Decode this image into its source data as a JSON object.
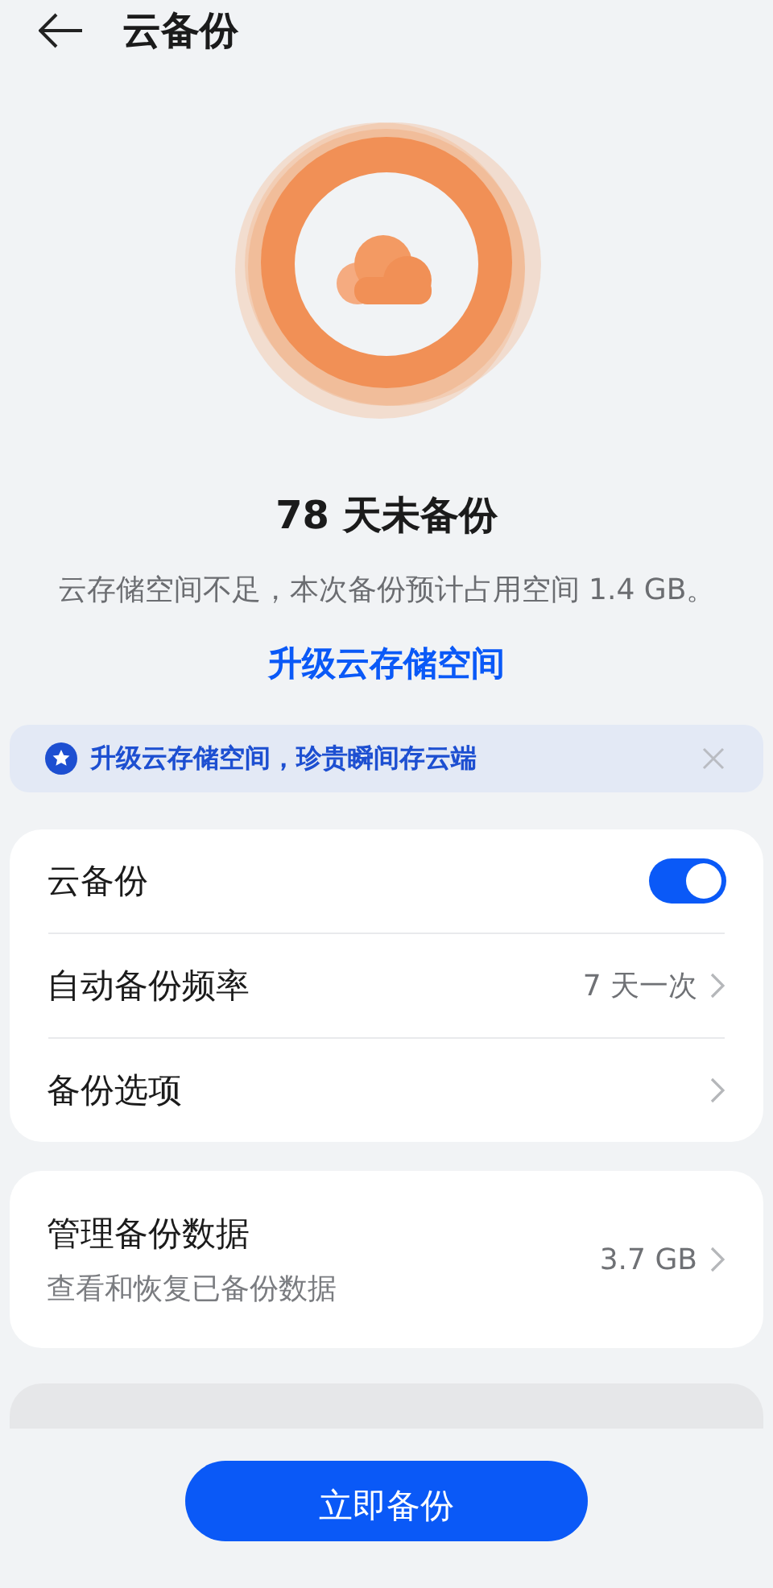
{
  "header": {
    "title": "云备份"
  },
  "hero": {
    "status": "78 天未备份",
    "message": "云存储空间不足，本次备份预计占用空间 1.4 GB。",
    "link": "升级云存储空间"
  },
  "banner": {
    "text": "升级云存储空间，珍贵瞬间存云端"
  },
  "groups": [
    [
      {
        "kind": "toggle",
        "label": "云备份",
        "on": true
      },
      {
        "kind": "value",
        "label": "自动备份频率",
        "value": "7 天一次"
      },
      {
        "kind": "nav",
        "label": "备份选项"
      }
    ],
    [
      {
        "kind": "detail",
        "label": "管理备份数据",
        "subtitle": "查看和恢复已备份数据",
        "value": "3.7 GB"
      }
    ]
  ],
  "primary_button": {
    "label": "立即备份"
  }
}
